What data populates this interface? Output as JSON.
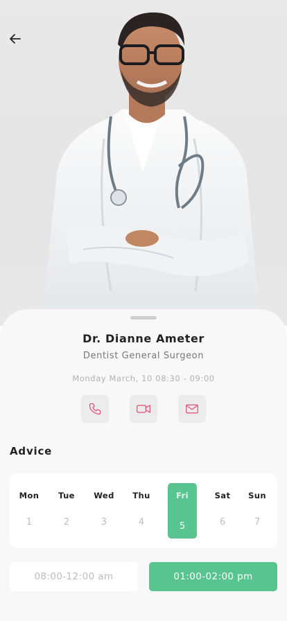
{
  "doctor": {
    "name": "Dr. Dianne Ameter",
    "specialty": "Dentist General Surgeon",
    "schedule": "Monday March, 10 08:30 - 09:00"
  },
  "section_title": "Advice",
  "calendar": {
    "days": [
      {
        "name": "Mon",
        "num": "1"
      },
      {
        "name": "Tue",
        "num": "2"
      },
      {
        "name": "Wed",
        "num": "3"
      },
      {
        "name": "Thu",
        "num": "4"
      },
      {
        "name": "Fri",
        "num": "5"
      },
      {
        "name": "Sat",
        "num": "6"
      },
      {
        "name": "Sun",
        "num": "7"
      }
    ],
    "selected": "Fri"
  },
  "time_slots": {
    "am": "08:00-12:00 am",
    "pm": "01:00-02:00 pm",
    "selected": "pm"
  },
  "icons": {
    "back": "arrow-left-icon",
    "call": "phone-icon",
    "video": "video-camera-icon",
    "email": "mail-icon"
  },
  "colors": {
    "accent": "#58c48f",
    "icon_tint": "#e05a7a",
    "sheet_bg": "#f8f8f8"
  }
}
